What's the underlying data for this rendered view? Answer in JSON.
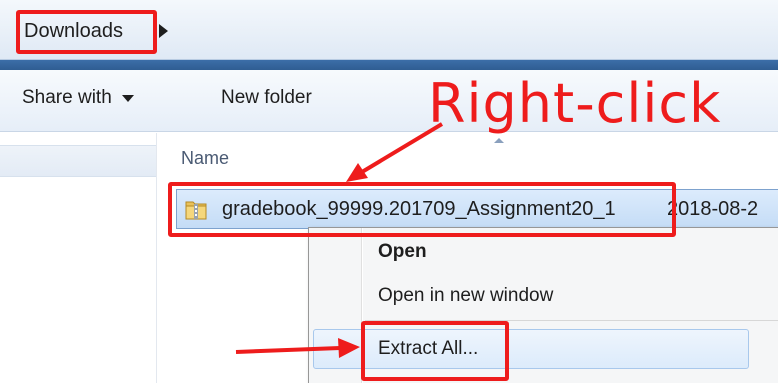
{
  "address_bar": {
    "current_folder": "Downloads"
  },
  "toolbar": {
    "share_label": "Share with",
    "new_folder_label": "New folder"
  },
  "file_list": {
    "columns": [
      "Name"
    ],
    "rows": [
      {
        "name": "gradebook_99999.201709_Assignment20_1",
        "date": "2018-08-2"
      }
    ]
  },
  "context_menu": {
    "items": [
      {
        "label": "Open"
      },
      {
        "label": "Open in new window"
      },
      {
        "label": "Extract All..."
      }
    ]
  },
  "annotations": {
    "callout": "Right-click"
  },
  "colors": {
    "annotation": "#ee1c1c",
    "selection": "#cde3fa",
    "address_bar": "#dfe9f5",
    "accent_strip": "#2f5d92"
  },
  "icons": {
    "file": "zip-folder-icon",
    "breadcrumb_separator": "chevron-right-icon",
    "share_dropdown": "caret-down-icon",
    "sort_indicator": "sort-up-icon"
  }
}
